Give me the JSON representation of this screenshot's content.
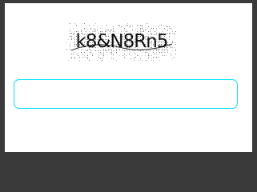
{
  "captcha": {
    "text": "k8&N8Rn5",
    "icon": "captcha-image"
  },
  "answer": {
    "value": "",
    "placeholder": ""
  },
  "colors": {
    "input_border": "#00e5ff",
    "background": "#3a3a3a",
    "panel": "#ffffff"
  }
}
